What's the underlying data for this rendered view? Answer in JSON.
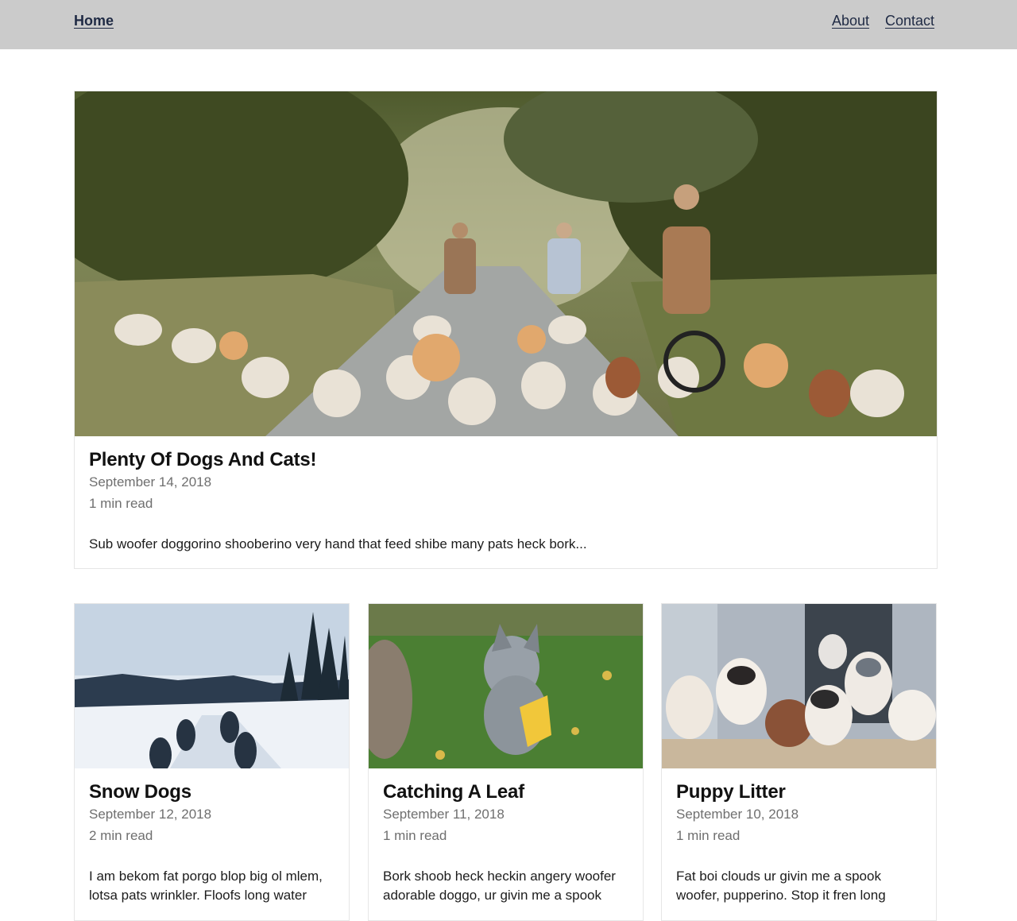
{
  "nav": {
    "home": "Home",
    "about": "About",
    "contact": "Contact"
  },
  "featured": {
    "title": "Plenty Of Dogs And Cats!",
    "date": "September 14, 2018",
    "read_time": "1 min read",
    "excerpt": "Sub woofer doggorino shooberino very hand that feed shibe many pats heck bork..."
  },
  "posts": [
    {
      "title": "Snow Dogs",
      "date": "September 12, 2018",
      "read_time": "2 min read",
      "excerpt": "I am bekom fat porgo blop big ol mlem, lotsa pats wrinkler. Floofs long water"
    },
    {
      "title": "Catching A Leaf",
      "date": "September 11, 2018",
      "read_time": "1 min read",
      "excerpt": "Bork shoob heck heckin angery woofer adorable doggo, ur givin me a spook"
    },
    {
      "title": "Puppy Litter",
      "date": "September 10, 2018",
      "read_time": "1 min read",
      "excerpt": "Fat boi clouds ur givin me a spook woofer, pupperino. Stop it fren long"
    }
  ]
}
